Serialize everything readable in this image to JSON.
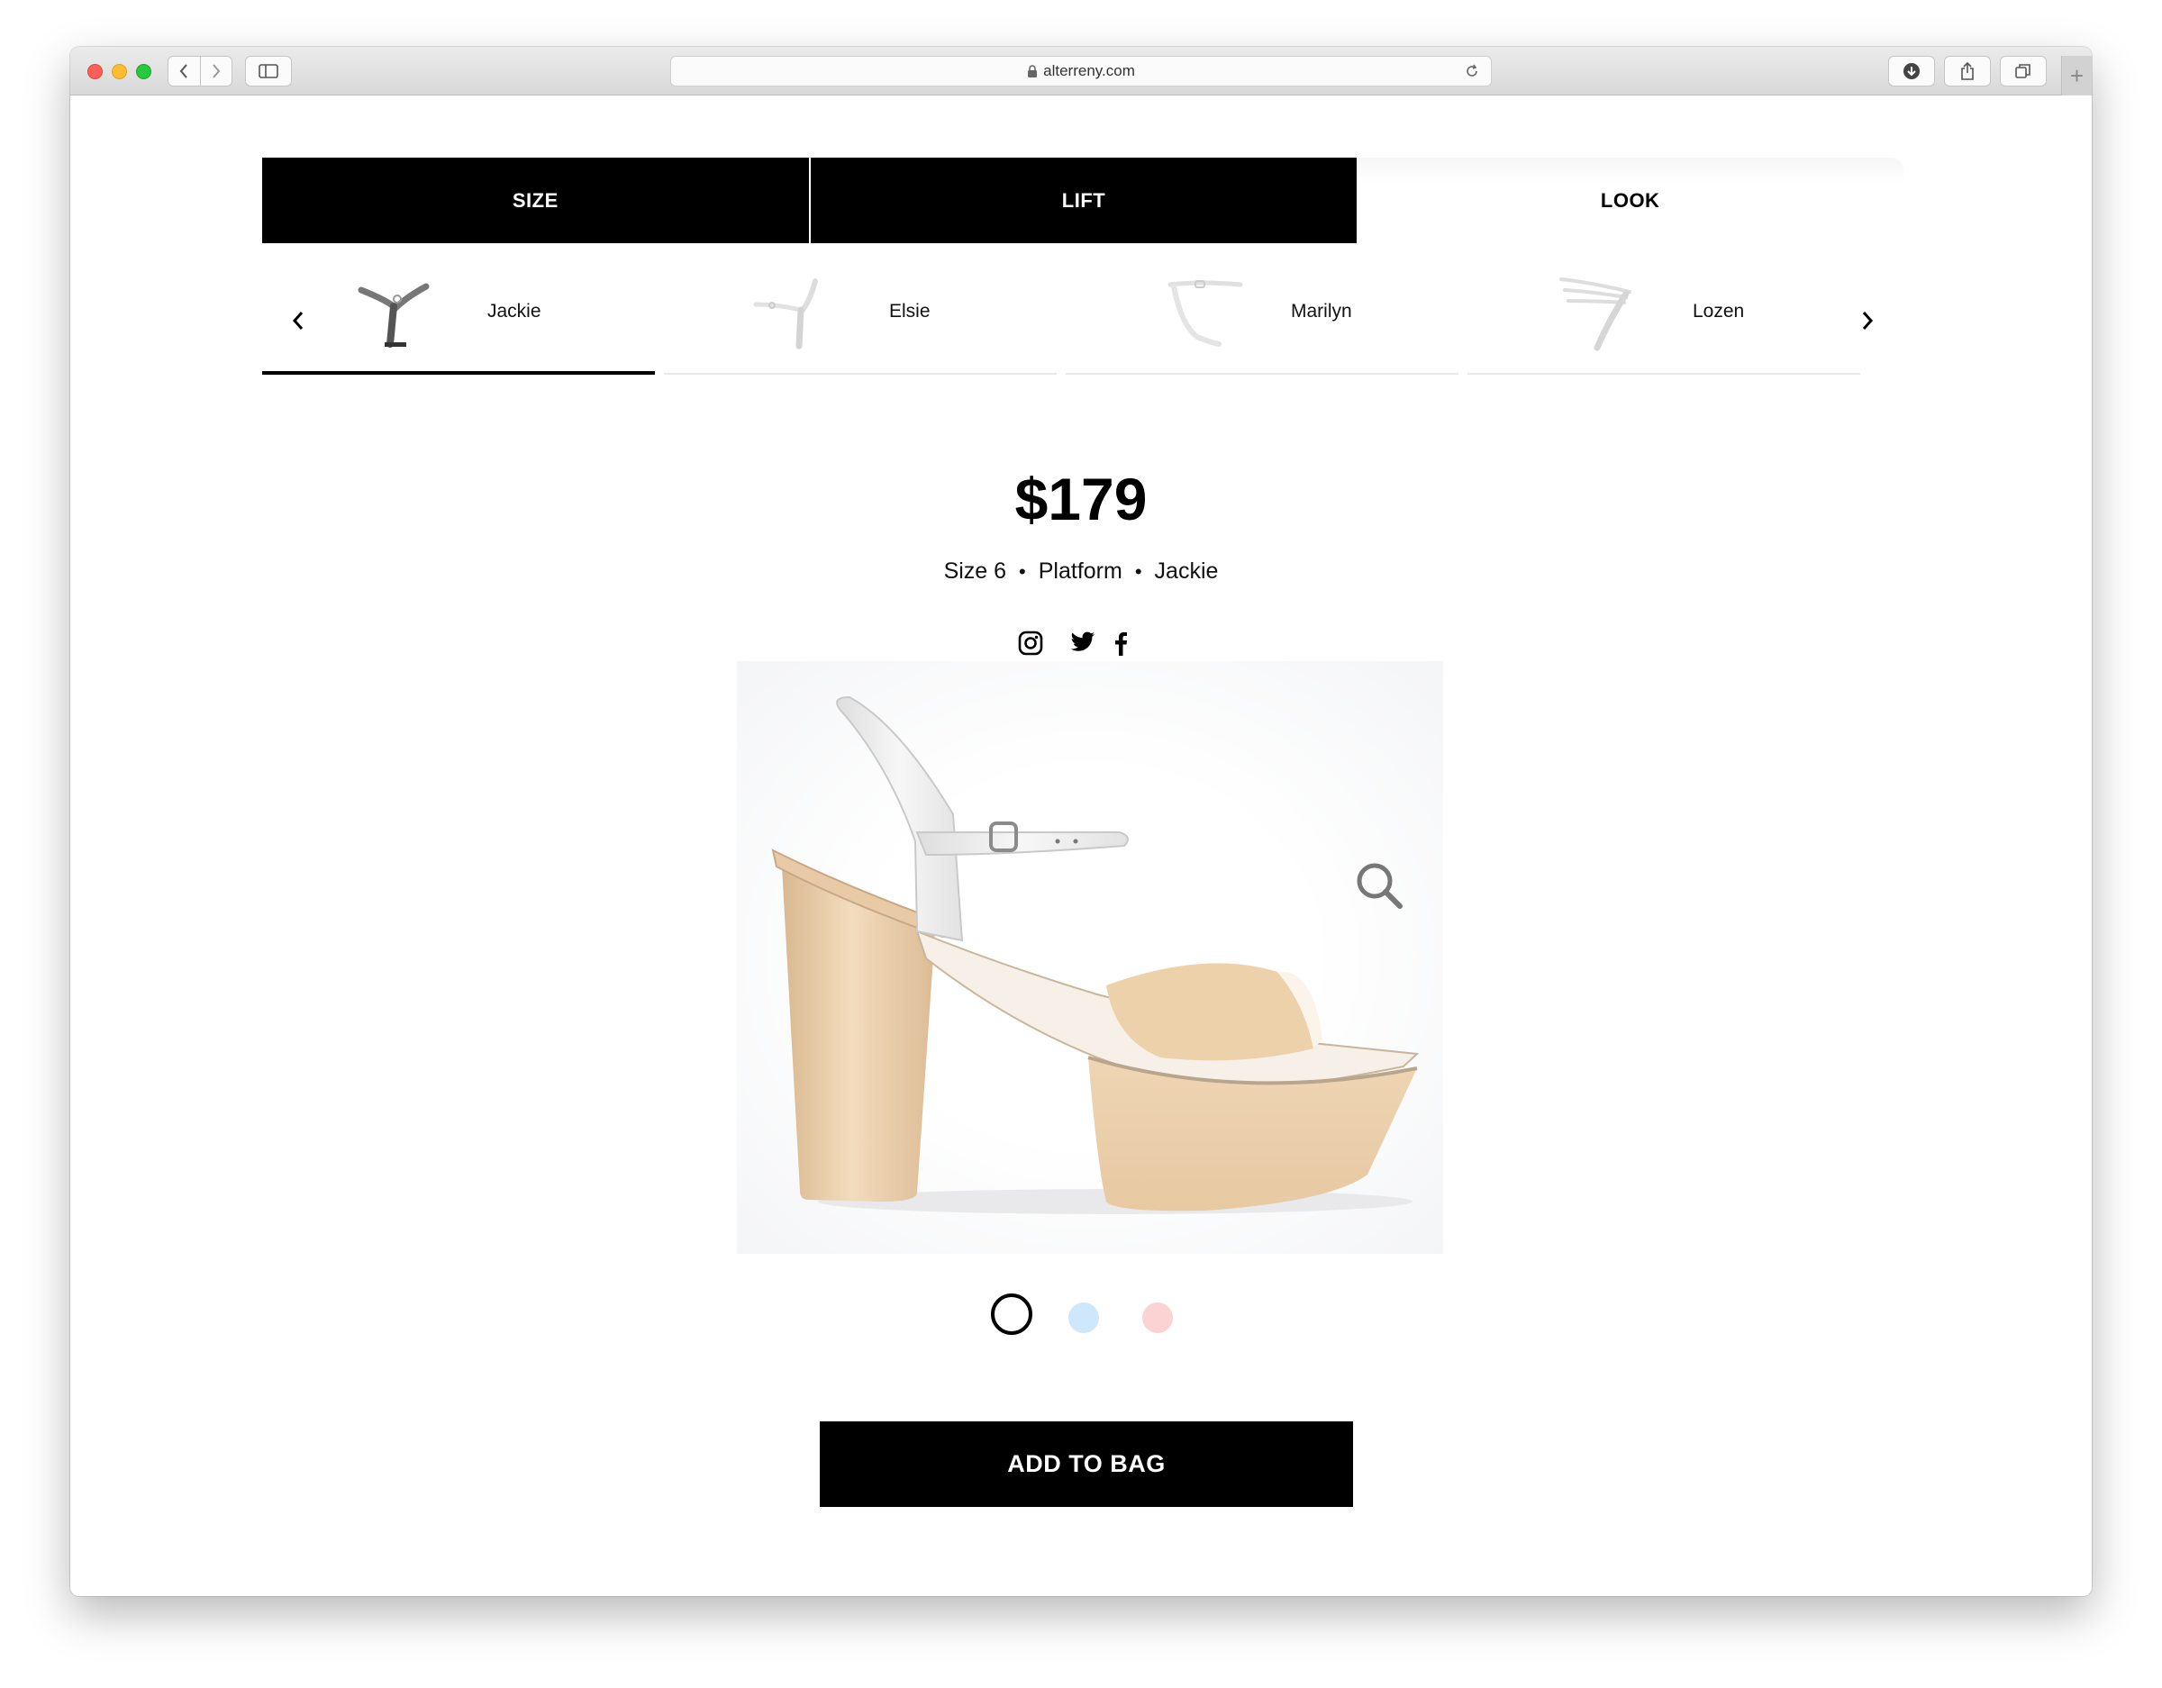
{
  "browser": {
    "url": "alterreny.com",
    "icons": [
      "back-icon",
      "forward-icon",
      "sidebar-icon",
      "lock-icon",
      "reload-icon",
      "download-icon",
      "share-icon",
      "tabs-icon",
      "new-tab-icon"
    ],
    "new_tab_label": "+"
  },
  "steps": [
    {
      "label": "SIZE",
      "state": "completed"
    },
    {
      "label": "LIFT",
      "state": "completed"
    },
    {
      "label": "LOOK",
      "state": "current"
    }
  ],
  "styles": {
    "items": [
      {
        "name": "Jackie",
        "active": true
      },
      {
        "name": "Elsie",
        "active": false
      },
      {
        "name": "Marilyn",
        "active": false
      },
      {
        "name": "Lozen",
        "active": false
      }
    ],
    "prev_icon": "chevron-left-icon",
    "next_icon": "chevron-right-icon"
  },
  "product": {
    "price": "$179",
    "size": "Size 6",
    "lift": "Platform",
    "look": "Jackie",
    "separator": "•",
    "social": [
      "instagram-icon",
      "twitter-icon",
      "facebook-icon"
    ],
    "image": "nude-platform-sandal-with-white-ankle-strap",
    "zoom_icon": "magnifier-icon"
  },
  "colors": {
    "swatches": [
      {
        "name": "nude",
        "color": "#ffffff",
        "selected": true
      },
      {
        "name": "blue",
        "color": "#cfe7fb",
        "selected": false
      },
      {
        "name": "pink",
        "color": "#fbd3d3",
        "selected": false
      }
    ],
    "accent": "#000000"
  },
  "cta": {
    "add_to_bag": "ADD TO BAG"
  }
}
